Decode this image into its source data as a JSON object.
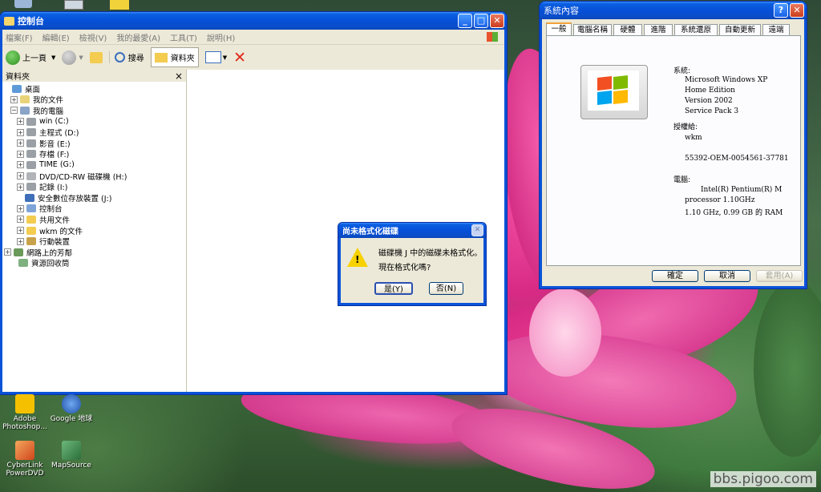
{
  "explorer": {
    "title": "控制台",
    "menu": [
      "檔案(F)",
      "編輯(E)",
      "檢視(V)",
      "我的最愛(A)",
      "工具(T)",
      "說明(H)"
    ],
    "toolbar": {
      "back": "上一頁",
      "search": "搜尋",
      "folders": "資料夾"
    },
    "folders_panel": {
      "title": "資料夾",
      "close": "×",
      "tree": [
        {
          "label": "桌面",
          "level": 0,
          "expand": ""
        },
        {
          "label": "我的文件",
          "level": 1,
          "expand": "+"
        },
        {
          "label": "我的電腦",
          "level": 1,
          "expand": "−"
        },
        {
          "label": "win (C:)",
          "level": 2,
          "expand": "+"
        },
        {
          "label": "主程式 (D:)",
          "level": 2,
          "expand": "+"
        },
        {
          "label": "影音 (E:)",
          "level": 2,
          "expand": "+"
        },
        {
          "label": "存檔 (F:)",
          "level": 2,
          "expand": "+"
        },
        {
          "label": "TIME (G:)",
          "level": 2,
          "expand": "+"
        },
        {
          "label": "DVD/CD-RW 磁碟機 (H:)",
          "level": 2,
          "expand": "+"
        },
        {
          "label": "記錄 (I:)",
          "level": 2,
          "expand": "+"
        },
        {
          "label": "安全數位存放裝置 (J:)",
          "level": 2,
          "expand": ""
        },
        {
          "label": "控制台",
          "level": 2,
          "expand": "+"
        },
        {
          "label": "共用文件",
          "level": 2,
          "expand": "+"
        },
        {
          "label": "wkm 的文件",
          "level": 2,
          "expand": "+"
        },
        {
          "label": "行動裝置",
          "level": 2,
          "expand": "+"
        },
        {
          "label": "網路上的芳鄰",
          "level": 0,
          "expand": "+"
        },
        {
          "label": "資源回收筒",
          "level": 1,
          "expand": ""
        }
      ]
    }
  },
  "format_dialog": {
    "title": "尚未格式化磁碟",
    "message_line1": "磁碟機 J 中的磁碟未格式化。",
    "message_line2": "現在格式化嗎?",
    "yes": "是(Y)",
    "no": "否(N)"
  },
  "sysprops": {
    "title": "系統內容",
    "help": "?",
    "tabs": [
      "一般",
      "電腦名稱",
      "硬體",
      "進階",
      "系統還原",
      "自動更新",
      "遠端"
    ],
    "system_label": "系統:",
    "system_lines": [
      "Microsoft Windows XP",
      "Home Edition",
      "Version 2002",
      "Service Pack 3"
    ],
    "registered_label": "授權給:",
    "registered_user": "wkm",
    "product_id": "55392-OEM-0054561-37781",
    "computer_label": "電腦:",
    "computer_lines": [
      "Intel(R) Pentium(R) M",
      "processor 1.10GHz",
      "1.10 GHz, 0.99 GB 的 RAM"
    ],
    "ok": "確定",
    "cancel": "取消",
    "apply": "套用(A)"
  },
  "desktop_icons": [
    {
      "label": "Adobe Photoshop...",
      "color": "#f5c000"
    },
    {
      "label": "Google 地球",
      "color": "#2f6fd0"
    },
    {
      "label": "CyberLink PowerDVD",
      "color": "#e0702a"
    },
    {
      "label": "MapSource",
      "color": "#3c8a4a"
    }
  ],
  "watermark": "bbs.pigoo.com"
}
